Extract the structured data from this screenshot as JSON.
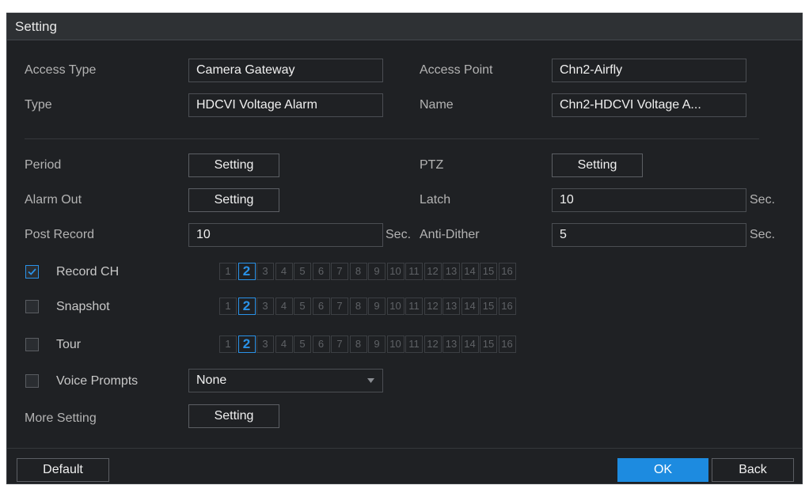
{
  "title": "Setting",
  "access_type": {
    "label": "Access Type",
    "value": "Camera Gateway"
  },
  "access_point": {
    "label": "Access Point",
    "value": "Chn2-Airfly"
  },
  "type": {
    "label": "Type",
    "value": "HDCVI Voltage Alarm"
  },
  "name": {
    "label": "Name",
    "value": "Chn2-HDCVI Voltage A..."
  },
  "period": {
    "label": "Period",
    "button": "Setting"
  },
  "ptz": {
    "label": "PTZ",
    "button": "Setting"
  },
  "alarm_out": {
    "label": "Alarm Out",
    "button": "Setting"
  },
  "latch": {
    "label": "Latch",
    "value": "10",
    "unit": "Sec."
  },
  "post_record": {
    "label": "Post Record",
    "value": "10",
    "unit": "Sec."
  },
  "anti_dither": {
    "label": "Anti-Dither",
    "value": "5",
    "unit": "Sec."
  },
  "record_ch": {
    "label": "Record CH",
    "checked": true
  },
  "snapshot": {
    "label": "Snapshot",
    "checked": false
  },
  "tour": {
    "label": "Tour",
    "checked": false
  },
  "channels": [
    "1",
    "2",
    "3",
    "4",
    "5",
    "6",
    "7",
    "8",
    "9",
    "10",
    "11",
    "12",
    "13",
    "14",
    "15",
    "16"
  ],
  "selected_channel": "2",
  "voice_prompts": {
    "label": "Voice Prompts",
    "checked": false,
    "value": "None"
  },
  "more_setting": {
    "label": "More Setting",
    "button": "Setting"
  },
  "footer": {
    "default": "Default",
    "ok": "OK",
    "back": "Back"
  },
  "colors": {
    "accent": "#1d8be0",
    "background": "#1f2124"
  }
}
